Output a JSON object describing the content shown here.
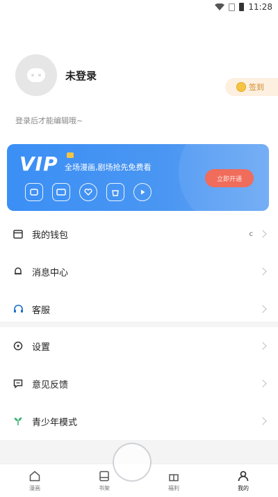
{
  "status_bar": {
    "time": "11:28"
  },
  "profile": {
    "login_status": "未登录",
    "hint": "登录后才能编辑哦~"
  },
  "signin": {
    "label": "签到"
  },
  "vip": {
    "logo": "VIP",
    "slogan": "全场漫画,剧场抢先免费看",
    "open_button": "立即开通",
    "perks": [
      "perk-icon-1",
      "perk-icon-2",
      "perk-icon-3",
      "perk-icon-4",
      "perk-icon-5"
    ]
  },
  "menu_a": [
    {
      "label": "我的钱包",
      "value": "c",
      "icon": "wallet-icon"
    },
    {
      "label": "消息中心",
      "value": "",
      "icon": "bell-icon"
    },
    {
      "label": "客服",
      "value": "",
      "icon": "headset-icon"
    }
  ],
  "menu_b": [
    {
      "label": "设置",
      "icon": "settings-icon"
    },
    {
      "label": "意见反馈",
      "icon": "feedback-icon"
    },
    {
      "label": "青少年模式",
      "icon": "sprout-icon"
    }
  ],
  "tabs": [
    {
      "label": "漫画",
      "icon": "home-icon"
    },
    {
      "label": "书架",
      "icon": "bookshelf-icon"
    },
    {
      "label": "福利",
      "icon": "gift-icon"
    },
    {
      "label": "我的",
      "icon": "user-icon"
    }
  ],
  "colors": {
    "vip_blue": "#3b8ff5",
    "vip_button": "#f06c5b",
    "signin_bg": "#fdf0e0",
    "sprout_green": "#3cb371"
  }
}
